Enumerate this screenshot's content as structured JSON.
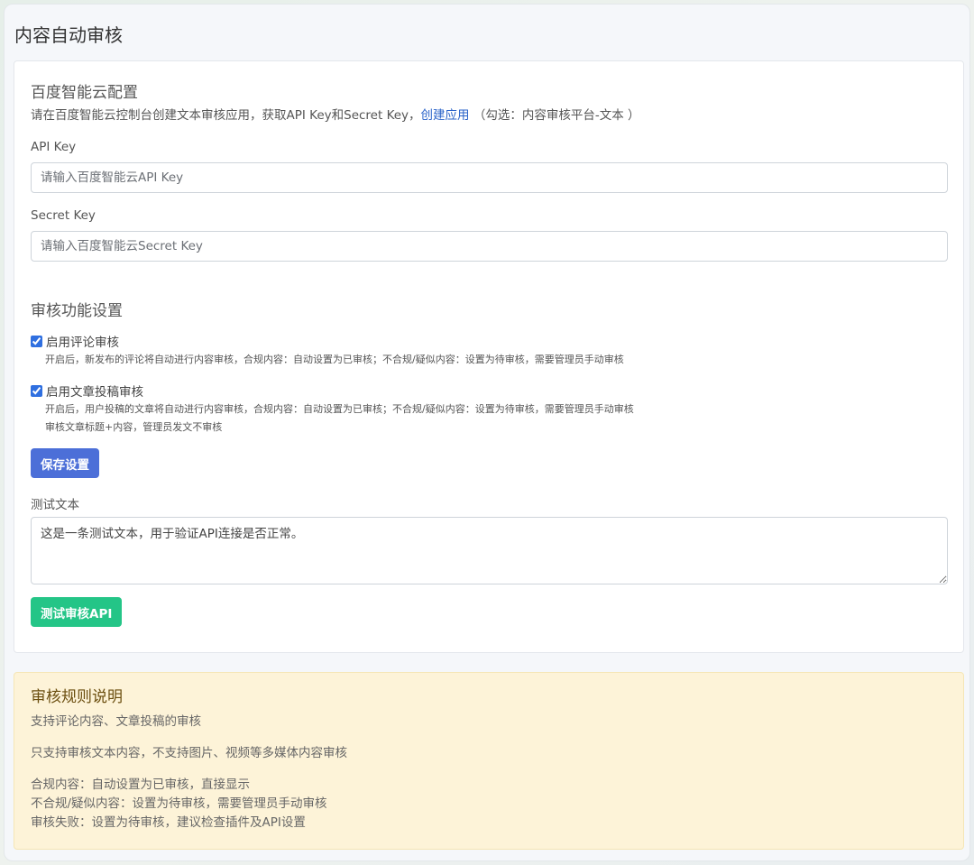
{
  "page": {
    "title": "内容自动审核"
  },
  "config": {
    "title": "百度智能云配置",
    "desc_before": "请在百度智能云控制台创建文本审核应用，获取API Key和Secret Key，",
    "desc_link": "创建应用",
    "desc_after": " （勾选：内容审核平台-文本 ）",
    "api_key_label": "API Key",
    "api_key_placeholder": "请输入百度智能云API Key",
    "secret_key_label": "Secret Key",
    "secret_key_placeholder": "请输入百度智能云Secret Key"
  },
  "features": {
    "title": "审核功能设置",
    "comment": {
      "label": "启用评论审核",
      "checked": true,
      "hint": "开启后，新发布的评论将自动进行内容审核，合规内容：自动设置为已审核；不合规/疑似内容：设置为待审核，需要管理员手动审核"
    },
    "post": {
      "label": "启用文章投稿审核",
      "checked": true,
      "hint1": "开启后，用户投稿的文章将自动进行内容审核，合规内容：自动设置为已审核；不合规/疑似内容：设置为待审核，需要管理员手动审核",
      "hint2": "审核文章标题+内容，管理员发文不审核"
    },
    "save_label": "保存设置"
  },
  "test": {
    "label": "测试文本",
    "value": "这是一条测试文本，用于验证API连接是否正常。",
    "button_label": "测试审核API"
  },
  "rules": {
    "title": "审核规则说明",
    "line1": "支持评论内容、文章投稿的审核",
    "line2": "只支持审核文本内容，不支持图片、视频等多媒体内容审核",
    "line3": "合规内容：自动设置为已审核，直接显示",
    "line4": "不合规/疑似内容：设置为待审核，需要管理员手动审核",
    "line5": "审核失败：设置为待审核，建议检查插件及API设置"
  },
  "colors": {
    "primary": "#4c6fd8",
    "success": "#24c587",
    "link": "#2a63c9",
    "notice_bg": "#fdf3d8",
    "notice_title": "#6b4e0f"
  }
}
